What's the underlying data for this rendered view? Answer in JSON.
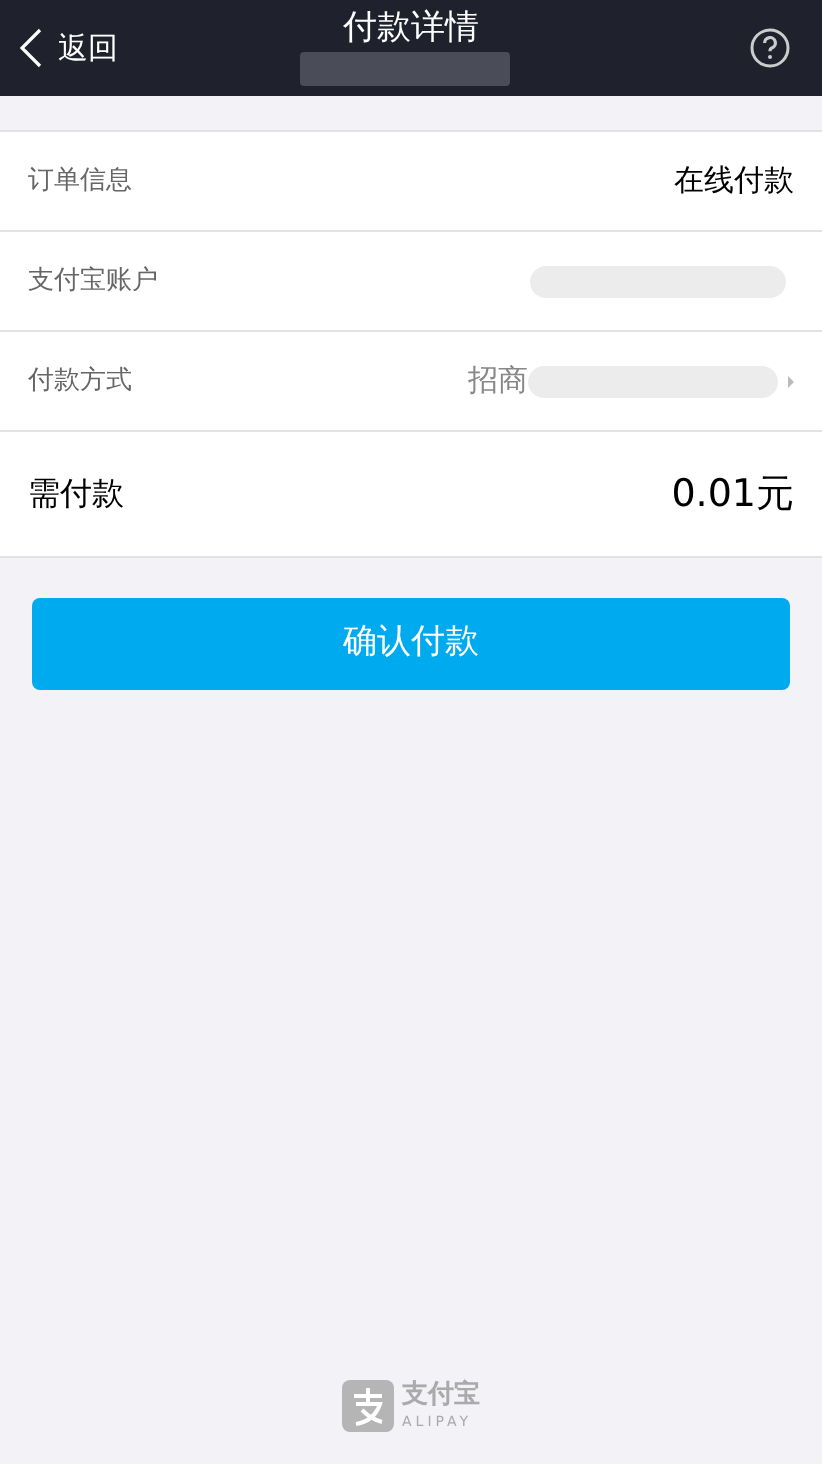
{
  "header": {
    "back": "返回",
    "title": "付款详情"
  },
  "rows": [
    {
      "kind": "info",
      "label": "订单信息",
      "value": "在线付款"
    },
    {
      "kind": "redacted",
      "label": "支付宝账户"
    },
    {
      "kind": "link",
      "label": "付款方式",
      "value": "招商"
    },
    {
      "kind": "total",
      "label": "需付款",
      "value": "0.01元"
    }
  ],
  "button": "确认付款",
  "footer": {
    "name": "支付宝",
    "latin": "ALIPAY"
  }
}
